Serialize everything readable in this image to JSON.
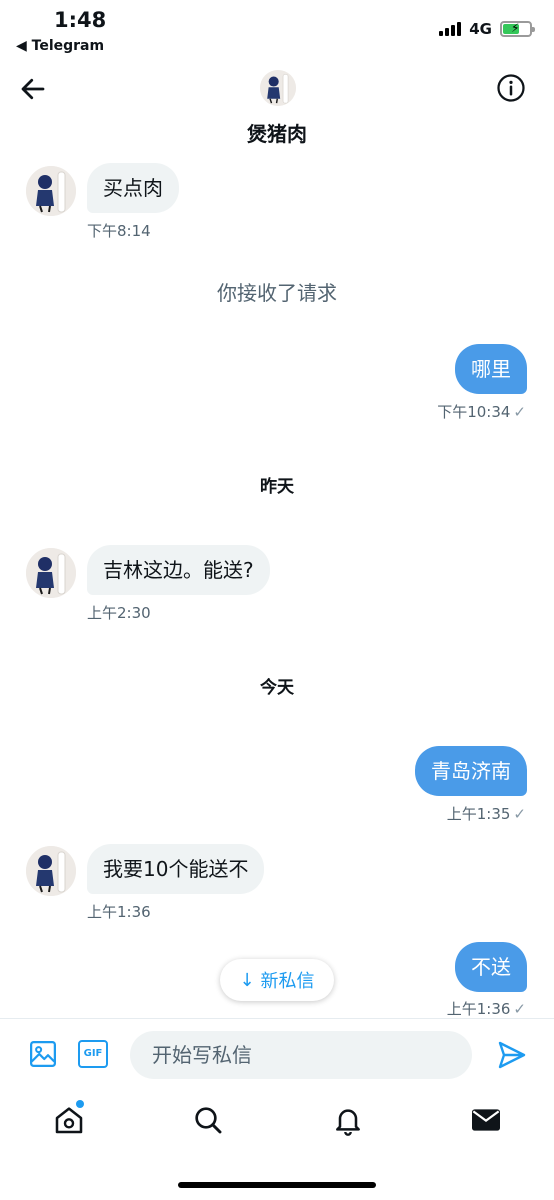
{
  "status_bar": {
    "time": "1:48",
    "back_app": "◀ Telegram",
    "network": "4G"
  },
  "header": {
    "contact_name": "煲猪肉"
  },
  "messages": [
    {
      "text": "买点肉",
      "time": "下午8:14"
    },
    {
      "notice": "你接收了请求"
    },
    {
      "text": "哪里",
      "time": "下午10:34",
      "check": "✓"
    },
    {
      "divider": "昨天"
    },
    {
      "text": "吉林这边。能送?",
      "time": "上午2:30"
    },
    {
      "divider": "今天"
    },
    {
      "text": "青岛济南",
      "time": "上午1:35",
      "check": "✓"
    },
    {
      "text": "我要10个能送不",
      "time": "上午1:36"
    },
    {
      "text": "不送",
      "time": "上午1:36",
      "check": "✓"
    }
  ],
  "new_messages_pill": {
    "arrow": "↓",
    "label": "新私信"
  },
  "composer": {
    "gif_label": "GIF",
    "placeholder": "开始写私信"
  },
  "colors": {
    "outgoing_bubble": "#4a9be8",
    "incoming_bubble": "#eff3f4",
    "accent": "#1d9bf0"
  },
  "icons": {
    "back": "arrow-left-icon",
    "info": "info-icon",
    "image": "image-icon",
    "send": "send-icon",
    "home": "home-icon",
    "search": "search-icon",
    "notifications": "bell-icon",
    "messages": "mail-icon"
  }
}
